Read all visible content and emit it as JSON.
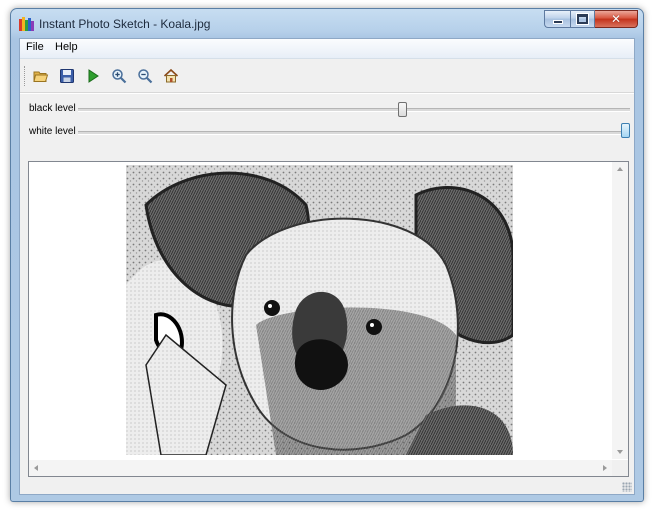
{
  "window": {
    "title": "Instant Photo Sketch - Koala.jpg",
    "icon": "app-colorbars-icon"
  },
  "caption_buttons": {
    "close_glyph": "✕"
  },
  "menu": {
    "items": [
      {
        "label": "File"
      },
      {
        "label": "Help"
      }
    ]
  },
  "toolbar": {
    "tools": [
      {
        "name": "open-folder-icon"
      },
      {
        "name": "save-disk-icon"
      },
      {
        "name": "play-icon"
      },
      {
        "name": "zoom-in-icon"
      },
      {
        "name": "zoom-out-icon"
      },
      {
        "name": "home-icon"
      }
    ]
  },
  "sliders": {
    "black_level": {
      "label": "black level",
      "value": 0.59
    },
    "white_level": {
      "label": "white level",
      "value": 1.0
    }
  },
  "colors": {
    "accent_thumb": "#a6d6f3",
    "close_button": "#c3321b",
    "window_frame": "#aec9e4"
  },
  "image": {
    "subject": "sketch-koala-image"
  }
}
